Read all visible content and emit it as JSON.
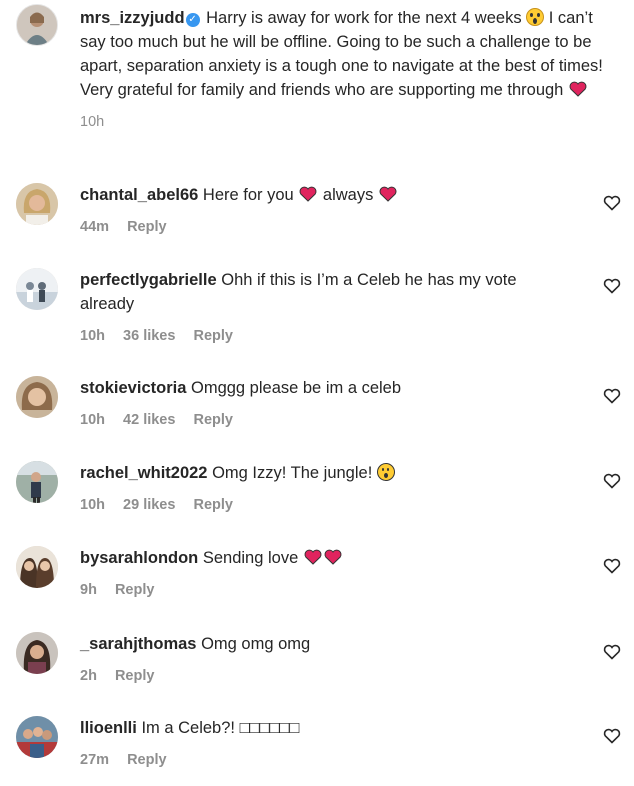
{
  "post": {
    "username": "mrs_izzyjudd",
    "text_1": "Harry is away for work for the next 4 weeks",
    "text_2": "I can’t say too much but he will be offline. Going to be such a challenge to be apart, separation anxiety is a tough one to navigate at the best of times! Very grateful for family and friends who are supporting me through",
    "time": "10h"
  },
  "comments": [
    {
      "username": "chantal_abel66",
      "text_a": "Here for you",
      "text_b": "always",
      "time": "44m",
      "likes": "",
      "reply": "Reply"
    },
    {
      "username": "perfectlygabrielle",
      "text_a": "Ohh if this is I’m a Celeb he has my vote already",
      "time": "10h",
      "likes": "36 likes",
      "reply": "Reply"
    },
    {
      "username": "stokievictoria",
      "text_a": "Omggg please be im a celeb",
      "time": "10h",
      "likes": "42 likes",
      "reply": "Reply"
    },
    {
      "username": "rachel_whit2022",
      "text_a": "Omg Izzy! The jungle!",
      "time": "10h",
      "likes": "29 likes",
      "reply": "Reply"
    },
    {
      "username": "bysarahlondon",
      "text_a": "Sending love",
      "time": "9h",
      "likes": "",
      "reply": "Reply"
    },
    {
      "username": "_sarahjthomas",
      "text_a": "Omg omg omg",
      "time": "2h",
      "likes": "",
      "reply": "Reply"
    },
    {
      "username": "llioenlli",
      "text_a": "Im a Celeb?! □□□□□□",
      "time": "27m",
      "likes": "",
      "reply": "Reply"
    }
  ],
  "icons": {
    "heart_color": "#e0245e",
    "verified_color": "#3897f0",
    "like": "heart-outline-icon"
  }
}
